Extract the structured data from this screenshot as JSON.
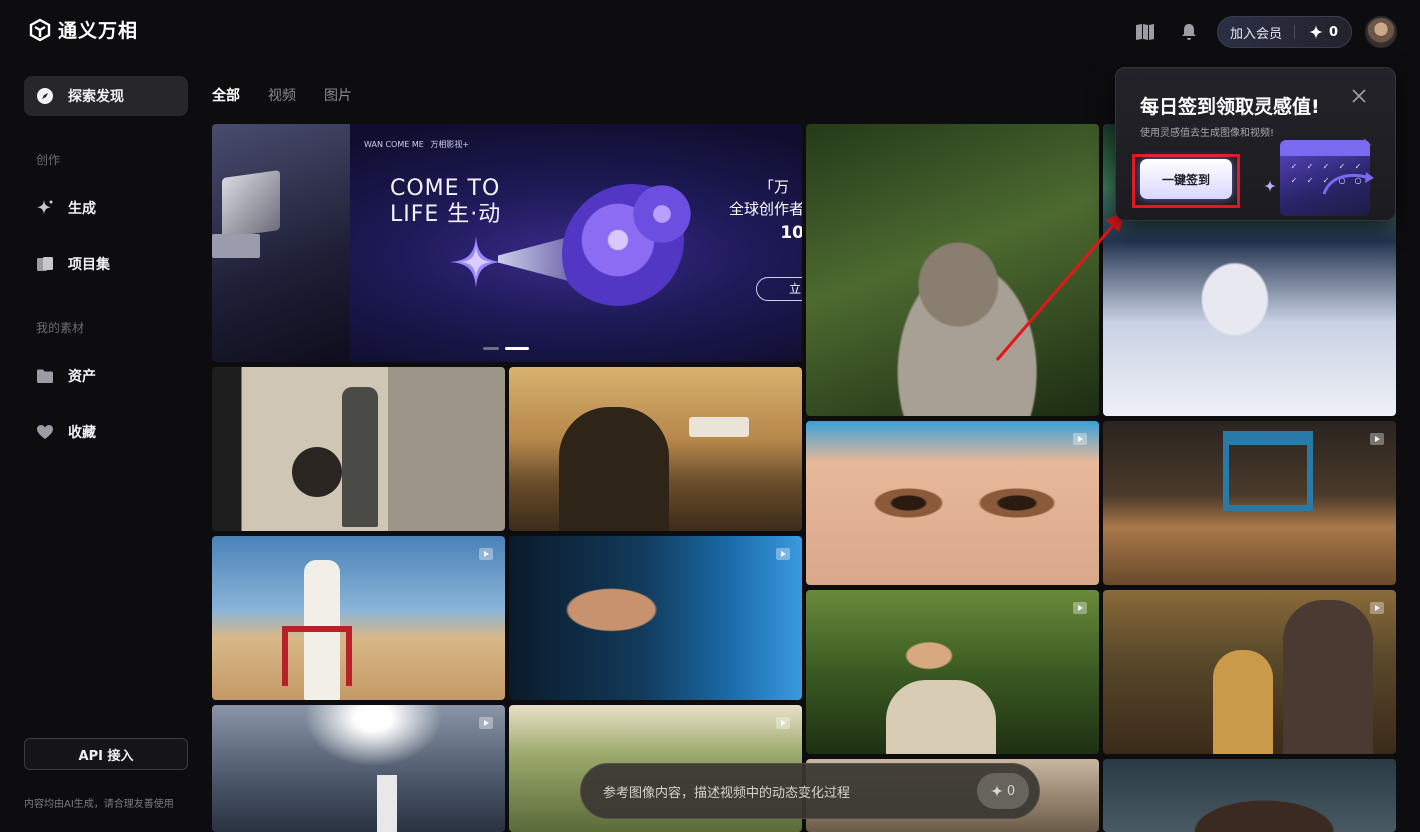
{
  "app": {
    "title": "通义万相"
  },
  "header": {
    "join_member": "加入会员",
    "points": "0"
  },
  "sidebar": {
    "items": [
      {
        "label": "探索发现",
        "icon": "compass-icon",
        "active": true
      },
      {
        "label": "生成",
        "icon": "sparkle-icon"
      },
      {
        "label": "项目集",
        "icon": "folders-icon"
      },
      {
        "label": "资产",
        "icon": "folder-icon"
      },
      {
        "label": "收藏",
        "icon": "heart-icon"
      }
    ],
    "sections": {
      "create": "创作",
      "my_materials": "我的素材"
    },
    "api_button": "API 接入",
    "disclaimer": "内容均由AI生成，请合理友善使用"
  },
  "tabs": [
    {
      "label": "全部",
      "active": true
    },
    {
      "label": "视频"
    },
    {
      "label": "图片"
    }
  ],
  "banner": {
    "brand": "WAN COME ME",
    "brand_small": "万相影视+",
    "headline_1": "COME TO",
    "headline_2": "LIFE 生·动",
    "right_1": "「万 ",
    "right_2": "全球创作者",
    "right_3": "10",
    "button": "立"
  },
  "popup": {
    "title": "每日签到领取灵感值!",
    "subtitle": "使用灵感值去生成图像和视频!",
    "checkin_button": "一键签到"
  },
  "prompt": {
    "placeholder": "参考图像内容，描述视频中的动态变化过程",
    "cost": "0"
  },
  "colors": {
    "background": "#0d0d0f",
    "annotation_red": "#e4161b",
    "sidebar_active": "#26262b"
  }
}
